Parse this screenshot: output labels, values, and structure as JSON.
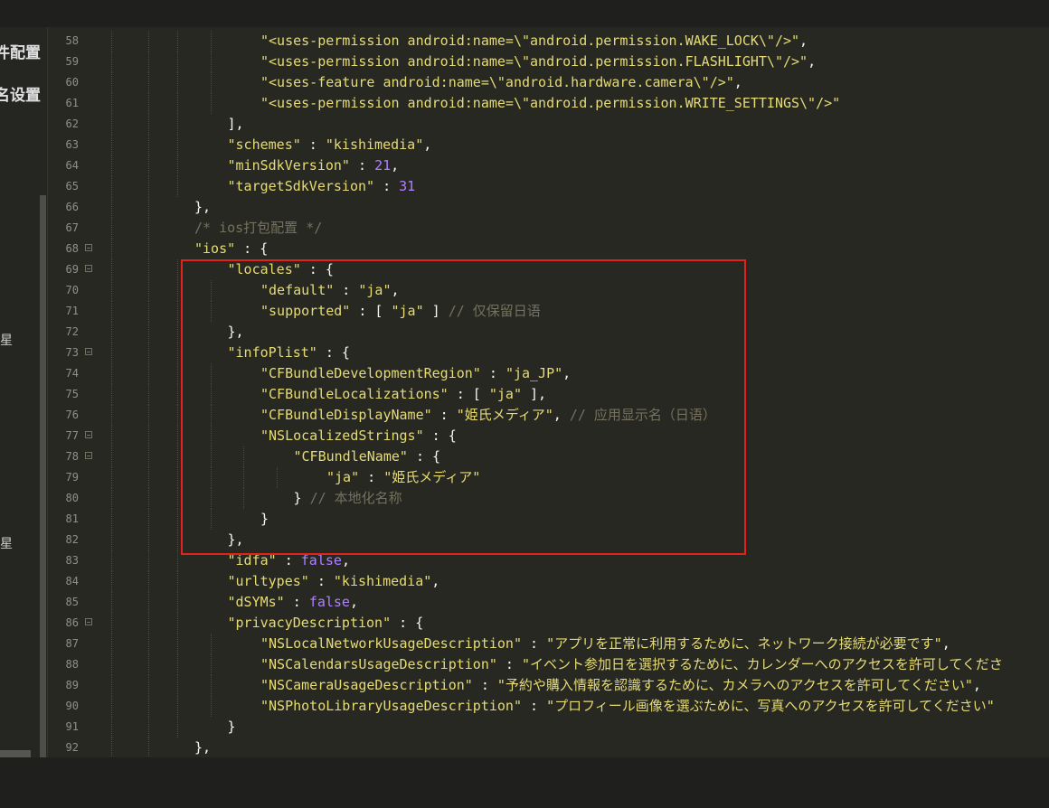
{
  "sidebar": {
    "items": [
      "件配置",
      "名设置"
    ],
    "marks": [
      "星",
      "星"
    ]
  },
  "colors": {
    "string": "#e6db74",
    "number": "#ae81ff",
    "comment": "#75715e",
    "plain": "#f8f8f2",
    "boolean": "#ae81ff",
    "highlight": "#e2231a"
  },
  "code": {
    "lines": [
      {
        "n": "58",
        "fold": false,
        "indent": 2,
        "tokens": [
          [
            "s",
            "\"<uses-permission android:name=\\\"android.permission.WAKE_LOCK\\\"/>\""
          ],
          [
            "p",
            ","
          ]
        ]
      },
      {
        "n": "59",
        "fold": false,
        "indent": 2,
        "tokens": [
          [
            "s",
            "\"<uses-permission android:name=\\\"android.permission.FLASHLIGHT\\\"/>\""
          ],
          [
            "p",
            ","
          ]
        ]
      },
      {
        "n": "60",
        "fold": false,
        "indent": 2,
        "tokens": [
          [
            "s",
            "\"<uses-feature android:name=\\\"android.hardware.camera\\\"/>\""
          ],
          [
            "p",
            ","
          ]
        ]
      },
      {
        "n": "61",
        "fold": false,
        "indent": 2,
        "tokens": [
          [
            "s",
            "\"<uses-permission android:name=\\\"android.permission.WRITE_SETTINGS\\\"/>\""
          ]
        ]
      },
      {
        "n": "62",
        "fold": false,
        "indent": 1,
        "tokens": [
          [
            "p",
            "],"
          ]
        ]
      },
      {
        "n": "63",
        "fold": false,
        "indent": 1,
        "tokens": [
          [
            "s",
            "\"schemes\""
          ],
          [
            "p",
            " : "
          ],
          [
            "s",
            "\"kishimedia\""
          ],
          [
            "p",
            ","
          ]
        ]
      },
      {
        "n": "64",
        "fold": false,
        "indent": 1,
        "tokens": [
          [
            "s",
            "\"minSdkVersion\""
          ],
          [
            "p",
            " : "
          ],
          [
            "m",
            "21"
          ],
          [
            "p",
            ","
          ]
        ]
      },
      {
        "n": "65",
        "fold": false,
        "indent": 1,
        "tokens": [
          [
            "s",
            "\"targetSdkVersion\""
          ],
          [
            "p",
            " : "
          ],
          [
            "m",
            "31"
          ]
        ]
      },
      {
        "n": "66",
        "fold": false,
        "indent": 0,
        "tokens": [
          [
            "p",
            "},"
          ]
        ]
      },
      {
        "n": "67",
        "fold": false,
        "indent": 0,
        "tokens": [
          [
            "c",
            "/* ios打包配置 */"
          ]
        ]
      },
      {
        "n": "68",
        "fold": true,
        "indent": 0,
        "tokens": [
          [
            "s",
            "\"ios\""
          ],
          [
            "p",
            " : {"
          ]
        ]
      },
      {
        "n": "69",
        "fold": true,
        "indent": 1,
        "tokens": [
          [
            "s",
            "\"locales\""
          ],
          [
            "p",
            " : {"
          ]
        ]
      },
      {
        "n": "70",
        "fold": false,
        "indent": 2,
        "tokens": [
          [
            "s",
            "\"default\""
          ],
          [
            "p",
            " : "
          ],
          [
            "s",
            "\"ja\""
          ],
          [
            "p",
            ","
          ]
        ]
      },
      {
        "n": "71",
        "fold": false,
        "indent": 2,
        "tokens": [
          [
            "s",
            "\"supported\""
          ],
          [
            "p",
            " : [ "
          ],
          [
            "s",
            "\"ja\""
          ],
          [
            "p",
            " ] "
          ],
          [
            "c",
            "// 仅保留日语"
          ]
        ]
      },
      {
        "n": "72",
        "fold": false,
        "indent": 1,
        "tokens": [
          [
            "p",
            "},"
          ]
        ]
      },
      {
        "n": "73",
        "fold": true,
        "indent": 1,
        "tokens": [
          [
            "s",
            "\"infoPlist\""
          ],
          [
            "p",
            " : {"
          ]
        ]
      },
      {
        "n": "74",
        "fold": false,
        "indent": 2,
        "tokens": [
          [
            "s",
            "\"CFBundleDevelopmentRegion\""
          ],
          [
            "p",
            " : "
          ],
          [
            "s",
            "\"ja_JP\""
          ],
          [
            "p",
            ","
          ]
        ]
      },
      {
        "n": "75",
        "fold": false,
        "indent": 2,
        "tokens": [
          [
            "s",
            "\"CFBundleLocalizations\""
          ],
          [
            "p",
            " : [ "
          ],
          [
            "s",
            "\"ja\""
          ],
          [
            "p",
            " ],"
          ]
        ]
      },
      {
        "n": "76",
        "fold": false,
        "indent": 2,
        "tokens": [
          [
            "s",
            "\"CFBundleDisplayName\""
          ],
          [
            "p",
            " : "
          ],
          [
            "s",
            "\"姫氏メディア\""
          ],
          [
            "p",
            ", "
          ],
          [
            "c",
            "// 应用显示名（日语）"
          ]
        ]
      },
      {
        "n": "77",
        "fold": true,
        "indent": 2,
        "tokens": [
          [
            "s",
            "\"NSLocalizedStrings\""
          ],
          [
            "p",
            " : {"
          ]
        ]
      },
      {
        "n": "78",
        "fold": true,
        "indent": 3,
        "tokens": [
          [
            "s",
            "\"CFBundleName\""
          ],
          [
            "p",
            " : {"
          ]
        ]
      },
      {
        "n": "79",
        "fold": false,
        "indent": 4,
        "tokens": [
          [
            "s",
            "\"ja\""
          ],
          [
            "p",
            " : "
          ],
          [
            "s",
            "\"姫氏メディア\""
          ]
        ]
      },
      {
        "n": "80",
        "fold": false,
        "indent": 3,
        "tokens": [
          [
            "p",
            "} "
          ],
          [
            "c",
            "// 本地化名称"
          ]
        ]
      },
      {
        "n": "81",
        "fold": false,
        "indent": 2,
        "tokens": [
          [
            "p",
            "}"
          ]
        ]
      },
      {
        "n": "82",
        "fold": false,
        "indent": 1,
        "tokens": [
          [
            "p",
            "},"
          ]
        ]
      },
      {
        "n": "83",
        "fold": false,
        "indent": 1,
        "tokens": [
          [
            "s",
            "\"idfa\""
          ],
          [
            "p",
            " : "
          ],
          [
            "b",
            "false"
          ],
          [
            "p",
            ","
          ]
        ]
      },
      {
        "n": "84",
        "fold": false,
        "indent": 1,
        "tokens": [
          [
            "s",
            "\"urltypes\""
          ],
          [
            "p",
            " : "
          ],
          [
            "s",
            "\"kishimedia\""
          ],
          [
            "p",
            ","
          ]
        ]
      },
      {
        "n": "85",
        "fold": false,
        "indent": 1,
        "tokens": [
          [
            "s",
            "\"dSYMs\""
          ],
          [
            "p",
            " : "
          ],
          [
            "b",
            "false"
          ],
          [
            "p",
            ","
          ]
        ]
      },
      {
        "n": "86",
        "fold": true,
        "indent": 1,
        "tokens": [
          [
            "s",
            "\"privacyDescription\""
          ],
          [
            "p",
            " : {"
          ]
        ]
      },
      {
        "n": "87",
        "fold": false,
        "indent": 2,
        "tokens": [
          [
            "s",
            "\"NSLocalNetworkUsageDescription\""
          ],
          [
            "p",
            " : "
          ],
          [
            "s",
            "\"アプリを正常に利用するために、ネットワーク接続が必要です\""
          ],
          [
            "p",
            ","
          ]
        ]
      },
      {
        "n": "88",
        "fold": false,
        "indent": 2,
        "tokens": [
          [
            "s",
            "\"NSCalendarsUsageDescription\""
          ],
          [
            "p",
            " : "
          ],
          [
            "s",
            "\"イベント参加日を選択するために、カレンダーへのアクセスを許可してくださ"
          ]
        ]
      },
      {
        "n": "89",
        "fold": false,
        "indent": 2,
        "tokens": [
          [
            "s",
            "\"NSCameraUsageDescription\""
          ],
          [
            "p",
            " : "
          ],
          [
            "s",
            "\"予約や購入情報を認識するために、カメラへのアクセスを許可してください\""
          ],
          [
            "p",
            ","
          ]
        ]
      },
      {
        "n": "90",
        "fold": false,
        "indent": 2,
        "tokens": [
          [
            "s",
            "\"NSPhotoLibraryUsageDescription\""
          ],
          [
            "p",
            " : "
          ],
          [
            "s",
            "\"プロフィール画像を選ぶために、写真へのアクセスを許可してください\""
          ]
        ]
      },
      {
        "n": "91",
        "fold": false,
        "indent": 1,
        "tokens": [
          [
            "p",
            "}"
          ]
        ]
      },
      {
        "n": "92",
        "fold": false,
        "indent": 0,
        "tokens": [
          [
            "p",
            "},"
          ]
        ]
      }
    ]
  }
}
